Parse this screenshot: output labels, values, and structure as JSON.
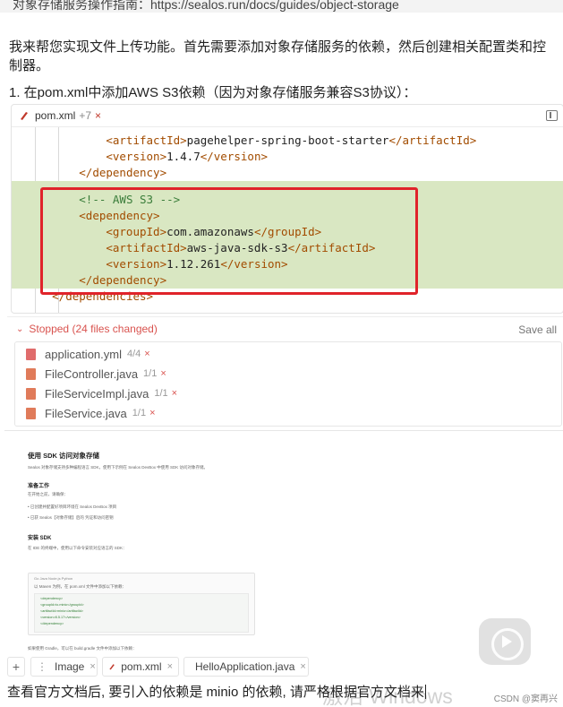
{
  "banner": {
    "text": "对象存储服务操作指南：https://sealos.run/docs/guides/object-storage"
  },
  "assistant": {
    "para1": "我来帮您实现文件上传功能。首先需要添加对象存储服务的依赖，然后创建相关配置类和控制器。",
    "para2": "1. 在pom.xml中添加AWS S3依赖（因为对象存储服务兼容S3协议）："
  },
  "code_panel": {
    "filename": "pom.xml",
    "added_count": "+7",
    "close": "×",
    "lines": {
      "l1_open": "<artifactId>",
      "l1_text": "pagehelper-spring-boot-starter",
      "l1_close": "</artifactId>",
      "l2_open": "<version>",
      "l2_text": "1.4.7",
      "l2_close": "</version>",
      "l3": "</dependency>",
      "l4": "<!-- AWS S3 -->",
      "l5": "<dependency>",
      "l6_open": "<groupId>",
      "l6_text": "com.amazonaws",
      "l6_close": "</groupId>",
      "l7_open": "<artifactId>",
      "l7_text": "aws-java-sdk-s3",
      "l7_close": "</artifactId>",
      "l8_open": "<version>",
      "l8_text": "1.12.261",
      "l8_close": "</version>",
      "l9": "</dependency>",
      "l10": "</dependencies>"
    }
  },
  "changes": {
    "status": "Stopped",
    "summary": "(24 files changed)",
    "save_all": "Save all",
    "files": [
      {
        "name": "application.yml",
        "count": "4/4",
        "icon_color": "#e06c6c"
      },
      {
        "name": "FileController.java",
        "count": "1/1",
        "icon_color": "#e07b5a"
      },
      {
        "name": "FileServiceImpl.java",
        "count": "1/1",
        "icon_color": "#e07b5a"
      },
      {
        "name": "FileService.java",
        "count": "1/1",
        "icon_color": "#e07b5a"
      }
    ],
    "close": "×"
  },
  "doc_preview": {
    "title": "使用 SDK 访问对象存储",
    "intro": "Sealos 对象存储支持多种编程语言 SDK，使用下示例在 Sealos DevBox 中使用 SDK 访问对象存储。",
    "h_prep": "准备工作",
    "prep_line": "在开始之前，请确保：",
    "prep_item1": "• 已创建并配置好项目环境在 Sealos DevBox 项目",
    "prep_item2": "• 已获 Sealos【对象存储】后的 凭证和访问密钥",
    "h_sdk": "安装 SDK",
    "sdk_line": "在 IDE 的终端中，使用以下命令安装对应语言的 SDK：",
    "tabs": "Go    Java    Node.js    Python",
    "maven_line": "以 Maven 为例，在 pom.xml 文件中添加以下依赖：",
    "code1": "<dependency>",
    "code2": "    <groupId>io.minio</groupId>",
    "code3": "    <artifactId>minio</artifactId>",
    "code4": "    <version>8.5.17</version>",
    "code5": "</dependency>",
    "gradle_line": "如果使用 Gradle，可以在 build.gradle 文件中添加以下依赖："
  },
  "context_chips": {
    "add": "+",
    "chip1": "Image",
    "chip2": "pom.xml",
    "chip3": "HelloApplication.java",
    "close": "×"
  },
  "input": {
    "text": "查看官方文档后, 要引入的依赖是 minio 的依赖, 请严格根据官方文档来"
  },
  "overlays": {
    "watermark": "激活 Windows",
    "csdn": "CSDN @窦再兴"
  },
  "colors": {
    "added_line_bg": "#d9e7c2",
    "highlight_border": "#e0232a",
    "stopped": "#d9534f"
  }
}
